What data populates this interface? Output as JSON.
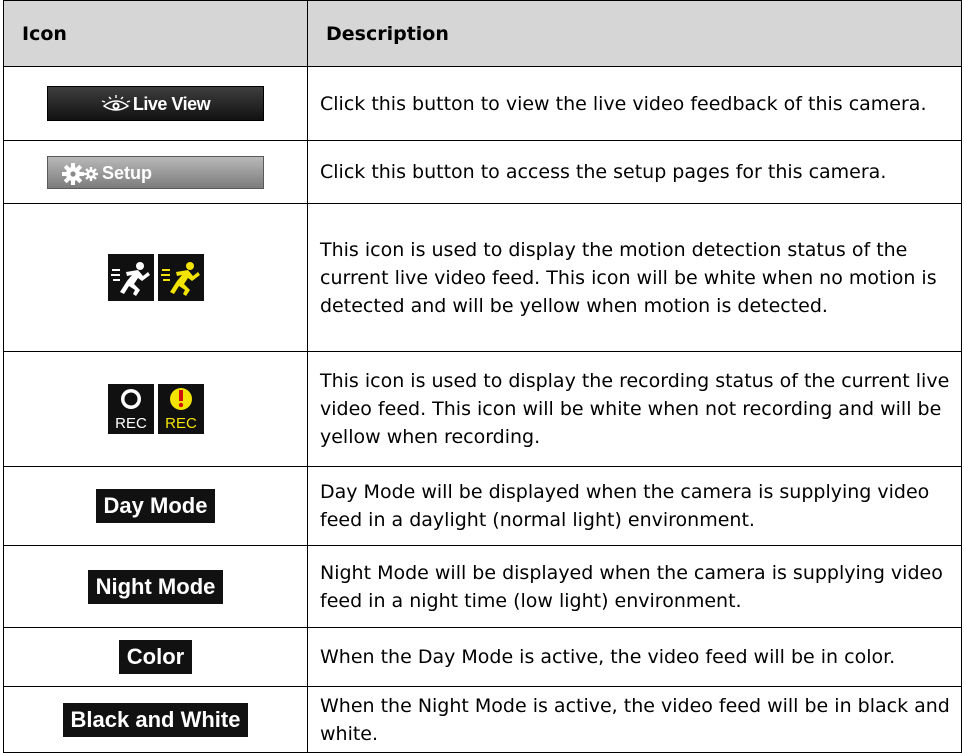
{
  "header": {
    "icon_col": "Icon",
    "desc_col": "Description"
  },
  "rows": [
    {
      "icon_label": "Live View",
      "icon_name": "eye-icon",
      "description": "Click this button to view the live video feedback of this camera."
    },
    {
      "icon_label": "Setup",
      "icon_name": "gear-icon",
      "description": "Click this button to access the setup pages for this camera."
    },
    {
      "icon_name": "running-person-icon",
      "description": "This icon is used to display the motion detection status of the current live video feed. This icon will be white when no motion is detected and will be yellow when motion is detected."
    },
    {
      "icon_label": "REC",
      "icon_label_2": "REC",
      "icon_name": "record-icon",
      "description": "This icon is used to display the recording status of the current live video feed. This icon will be white when not recording and will be yellow when recording."
    },
    {
      "icon_label": "Day Mode",
      "description": "Day Mode will be displayed when the camera is supplying video feed in a daylight (normal light) environment."
    },
    {
      "icon_label": "Night Mode",
      "description": "Night Mode will be displayed when the camera is supplying video feed in a night time (low light) environment."
    },
    {
      "icon_label": "Color",
      "description": "When the Day Mode is active, the video feed will be in color."
    },
    {
      "icon_label": "Black and White",
      "description": "When the Night Mode is active, the video feed will be in black and white."
    }
  ],
  "colors": {
    "header_bg": "#d6d6d6",
    "active_yellow": "#f2e400",
    "idle_white": "#ffffff",
    "icon_bg": "#101010"
  }
}
